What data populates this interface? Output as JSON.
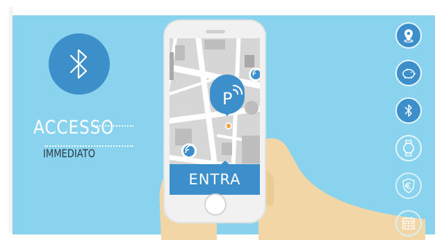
{
  "promo": {
    "title": "ACCESSO",
    "subtitle": "IMMEDIATO"
  },
  "phone": {
    "cta_label": "ENTRA",
    "map_pin_letter": "P"
  },
  "side_menu": {
    "items": [
      {
        "icon": "location-pin-icon"
      },
      {
        "icon": "piggy-bank-icon"
      },
      {
        "icon": "bluetooth-icon"
      },
      {
        "icon": "watch-icon"
      },
      {
        "icon": "euro-shield-icon"
      },
      {
        "icon": "calendar-icon"
      }
    ]
  },
  "colors": {
    "background": "#8ad3ee",
    "accent": "#3c8fca",
    "dark_text": "#2a3a46",
    "pin_orange": "#f7a24b"
  }
}
